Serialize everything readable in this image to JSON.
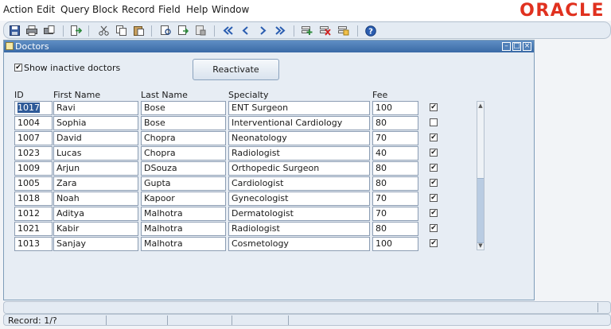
{
  "menubar": {
    "items": [
      "Action",
      "Edit",
      "Query",
      "Block",
      "Record",
      "Field",
      "Help",
      "Window"
    ],
    "brand": "ORACLE"
  },
  "window": {
    "title": "Doctors",
    "show_inactive_label": "Show inactive doctors",
    "show_inactive_checked": true,
    "reactivate_label": "Reactivate"
  },
  "table": {
    "headers": [
      "ID",
      "First Name",
      "Last Name",
      "Specialty",
      "Fee"
    ],
    "rows": [
      {
        "id": "1017",
        "first": "Ravi",
        "last": "Bose",
        "specialty": "ENT Surgeon",
        "fee": "100",
        "active": true
      },
      {
        "id": "1004",
        "first": "Sophia",
        "last": "Bose",
        "specialty": "Interventional Cardiology",
        "fee": "80",
        "active": false
      },
      {
        "id": "1007",
        "first": "David",
        "last": "Chopra",
        "specialty": "Neonatology",
        "fee": "70",
        "active": true
      },
      {
        "id": "1023",
        "first": "Lucas",
        "last": "Chopra",
        "specialty": "Radiologist",
        "fee": "40",
        "active": true
      },
      {
        "id": "1009",
        "first": "Arjun",
        "last": "DSouza",
        "specialty": "Orthopedic Surgeon",
        "fee": "80",
        "active": true
      },
      {
        "id": "1005",
        "first": "Zara",
        "last": "Gupta",
        "specialty": "Cardiologist",
        "fee": "80",
        "active": true
      },
      {
        "id": "1018",
        "first": "Noah",
        "last": "Kapoor",
        "specialty": "Gynecologist",
        "fee": "70",
        "active": true
      },
      {
        "id": "1012",
        "first": "Aditya",
        "last": "Malhotra",
        "specialty": "Dermatologist",
        "fee": "70",
        "active": true
      },
      {
        "id": "1021",
        "first": "Kabir",
        "last": "Malhotra",
        "specialty": "Radiologist",
        "fee": "80",
        "active": true
      },
      {
        "id": "1013",
        "first": "Sanjay",
        "last": "Malhotra",
        "specialty": "Cosmetology",
        "fee": "100",
        "active": true
      }
    ]
  },
  "status": {
    "record": "Record: 1/?"
  },
  "colors": {
    "brand": "#e0311f",
    "titlebar": "#3a6aa6",
    "selection": "#2f5a98"
  }
}
